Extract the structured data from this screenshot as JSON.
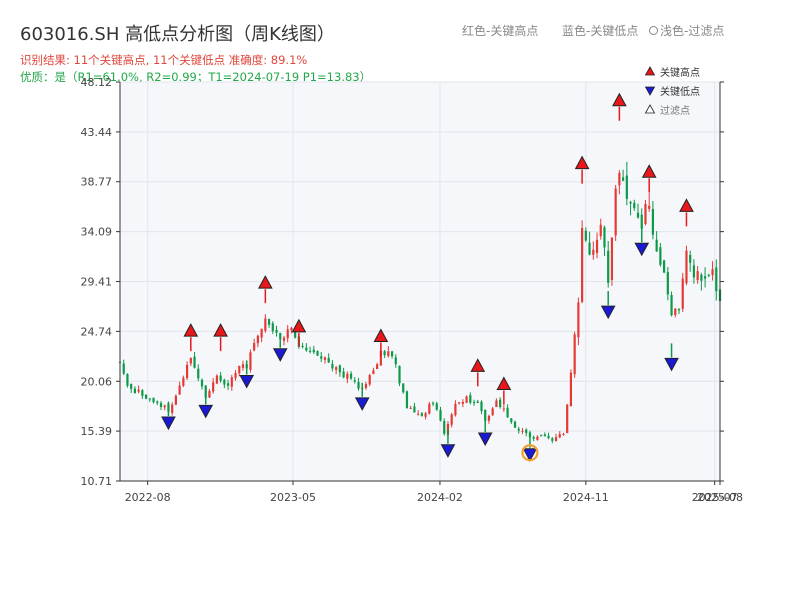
{
  "header": {
    "title": "603016.SH 高低点分析图（周K线图）",
    "legend_red": "红色-关键高点",
    "legend_blue": "蓝色-关键低点",
    "legend_light": "浅色-过滤点",
    "result_line": "识别结果: 11个关键高点, 11个关键低点   准确度: 89.1%",
    "quality_line": "优质：是（R1=61.0%, R2=0.99；T1=2024-07-19 P1=13.83）"
  },
  "chart_data": {
    "type": "candlestick",
    "title": "603016.SH 高低点分析图（周K线图）",
    "ylim": [
      10.71,
      48.12
    ],
    "y_ticks": [
      10.71,
      15.39,
      20.06,
      24.74,
      29.41,
      34.09,
      38.77,
      43.44,
      48.12
    ],
    "y_tick_labels": [
      "10.71",
      "15.39",
      "20.06",
      "24.74",
      "29.41",
      "34.09",
      "38.77",
      "43.44",
      "48.12"
    ],
    "x_range": [
      "2022-06-10",
      "2025-07-11"
    ],
    "x_ticks": [
      "2022-08",
      "2023-05",
      "2024-02",
      "2024-11",
      "2025-07",
      "2025-08"
    ],
    "grid": true,
    "colors": {
      "up": "#e53935",
      "down": "#0a9a48",
      "high_marker": "#e8171b",
      "low_marker": "#1a1ad6",
      "circle": "#f0a030"
    },
    "legend": {
      "position": "top-right",
      "entries": [
        {
          "label": "关键高点",
          "marker": "up-triangle",
          "color": "#e8171b"
        },
        {
          "label": "关键低点",
          "marker": "down-triangle",
          "color": "#1a1ad6"
        },
        {
          "label": "过滤点",
          "marker": "up-triangle-hollow",
          "color": "#ffffff"
        }
      ]
    },
    "key_highs": [
      {
        "date": "2022-10-21",
        "value": 24.2
      },
      {
        "date": "2022-12-16",
        "value": 24.2
      },
      {
        "date": "2023-03-10",
        "value": 28.7
      },
      {
        "date": "2023-05-12",
        "value": 24.6
      },
      {
        "date": "2023-10-13",
        "value": 23.7
      },
      {
        "date": "2024-04-12",
        "value": 20.9
      },
      {
        "date": "2024-05-31",
        "value": 19.2
      },
      {
        "date": "2024-10-25",
        "value": 39.9
      },
      {
        "date": "2025-01-03",
        "value": 45.8
      },
      {
        "date": "2025-02-28",
        "value": 39.1
      },
      {
        "date": "2025-05-09",
        "value": 35.9
      }
    ],
    "key_lows": [
      {
        "date": "2022-09-09",
        "value": 16.8
      },
      {
        "date": "2022-11-18",
        "value": 17.9
      },
      {
        "date": "2023-02-03",
        "value": 20.7
      },
      {
        "date": "2023-04-07",
        "value": 23.2
      },
      {
        "date": "2023-09-08",
        "value": 18.6
      },
      {
        "date": "2024-02-16",
        "value": 14.2
      },
      {
        "date": "2024-04-26",
        "value": 15.3
      },
      {
        "date": "2024-07-19",
        "value": 13.83
      },
      {
        "date": "2024-12-13",
        "value": 27.2
      },
      {
        "date": "2025-02-14",
        "value": 33.1
      },
      {
        "date": "2025-04-11",
        "value": 22.3
      }
    ],
    "circled_point": {
      "date": "2024-07-19",
      "value": 13.83
    },
    "close_path": [
      [
        "2022-06-10",
        21.8
      ],
      [
        "2022-06-24",
        19.6
      ],
      [
        "2022-07-22",
        18.8
      ],
      [
        "2022-08-19",
        18.2
      ],
      [
        "2022-09-09",
        17.3
      ],
      [
        "2022-09-30",
        19.6
      ],
      [
        "2022-10-21",
        22.5
      ],
      [
        "2022-11-04",
        20.6
      ],
      [
        "2022-11-18",
        18.6
      ],
      [
        "2022-12-09",
        20.4
      ],
      [
        "2022-12-30",
        19.5
      ],
      [
        "2023-01-20",
        21.8
      ],
      [
        "2023-02-03",
        21.4
      ],
      [
        "2023-02-17",
        24.0
      ],
      [
        "2023-03-10",
        26.0
      ],
      [
        "2023-03-24",
        24.6
      ],
      [
        "2023-04-07",
        23.9
      ],
      [
        "2023-04-28",
        25.0
      ],
      [
        "2023-05-12",
        23.6
      ],
      [
        "2023-06-02",
        22.9
      ],
      [
        "2023-06-30",
        22.1
      ],
      [
        "2023-07-28",
        20.8
      ],
      [
        "2023-08-18",
        20.3
      ],
      [
        "2023-09-08",
        19.3
      ],
      [
        "2023-09-29",
        21.3
      ],
      [
        "2023-10-13",
        22.6
      ],
      [
        "2023-10-27",
        22.9
      ],
      [
        "2023-11-10",
        21.4
      ],
      [
        "2023-12-01",
        17.6
      ],
      [
        "2023-12-29",
        16.7
      ],
      [
        "2024-01-19",
        18.2
      ],
      [
        "2024-02-09",
        15.2
      ],
      [
        "2024-03-01",
        17.8
      ],
      [
        "2024-03-22",
        18.5
      ],
      [
        "2024-04-12",
        17.9
      ],
      [
        "2024-04-26",
        16.3
      ],
      [
        "2024-05-17",
        18.4
      ],
      [
        "2024-05-31",
        17.4
      ],
      [
        "2024-06-21",
        15.8
      ],
      [
        "2024-07-12",
        15.0
      ],
      [
        "2024-07-19",
        14.7
      ],
      [
        "2024-08-02",
        14.9
      ],
      [
        "2024-08-30",
        14.6
      ],
      [
        "2024-09-20",
        15.1
      ],
      [
        "2024-10-04",
        20.9
      ],
      [
        "2024-10-18",
        27.6
      ],
      [
        "2024-10-25",
        35.0
      ],
      [
        "2024-11-08",
        32.5
      ],
      [
        "2024-11-29",
        34.6
      ],
      [
        "2024-12-13",
        29.4
      ],
      [
        "2024-12-27",
        37.5
      ],
      [
        "2025-01-03",
        40.6
      ],
      [
        "2025-01-17",
        36.7
      ],
      [
        "2025-01-31",
        36.2
      ],
      [
        "2025-02-14",
        35.1
      ],
      [
        "2025-02-28",
        36.9
      ],
      [
        "2025-03-14",
        32.2
      ],
      [
        "2025-03-28",
        30.1
      ],
      [
        "2025-04-11",
        26.2
      ],
      [
        "2025-04-25",
        26.9
      ],
      [
        "2025-05-09",
        31.6
      ],
      [
        "2025-05-23",
        30.1
      ],
      [
        "2025-06-06",
        29.3
      ],
      [
        "2025-06-27",
        29.9
      ],
      [
        "2025-07-11",
        27.3
      ]
    ]
  }
}
